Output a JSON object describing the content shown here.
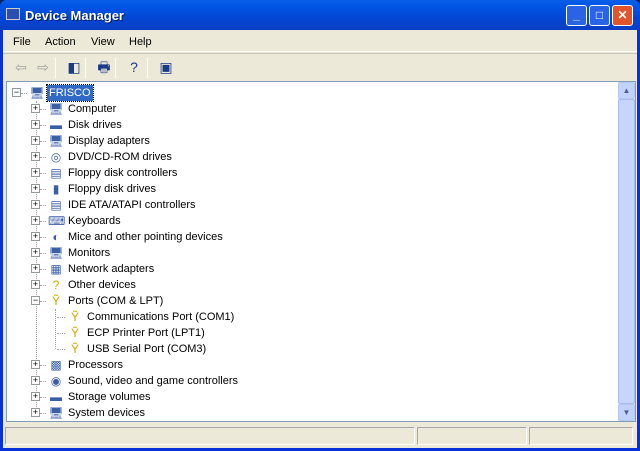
{
  "window": {
    "title": "Device Manager"
  },
  "menu": [
    "File",
    "Action",
    "View",
    "Help"
  ],
  "toolbar": [
    {
      "name": "back-icon",
      "glyph": "⇦"
    },
    {
      "name": "forward-icon",
      "glyph": "⇨"
    },
    {
      "name": "show-hide-console-tree-icon",
      "glyph": "◧"
    },
    {
      "name": "print-icon",
      "glyph": "🖶"
    },
    {
      "name": "help-icon",
      "glyph": "?"
    },
    {
      "name": "update-driver-icon",
      "glyph": "▣"
    }
  ],
  "tree": {
    "root": "FRISCO",
    "items": [
      {
        "label": "Computer",
        "icon": "computer-icon",
        "expanded": false
      },
      {
        "label": "Disk drives",
        "icon": "disk-drive-icon",
        "expanded": false
      },
      {
        "label": "Display adapters",
        "icon": "display-adapter-icon",
        "expanded": false
      },
      {
        "label": "DVD/CD-ROM drives",
        "icon": "cdrom-icon",
        "expanded": false
      },
      {
        "label": "Floppy disk controllers",
        "icon": "floppy-controller-icon",
        "expanded": false
      },
      {
        "label": "Floppy disk drives",
        "icon": "floppy-drive-icon",
        "expanded": false
      },
      {
        "label": "IDE ATA/ATAPI controllers",
        "icon": "ide-controller-icon",
        "expanded": false
      },
      {
        "label": "Keyboards",
        "icon": "keyboard-icon",
        "expanded": false
      },
      {
        "label": "Mice and other pointing devices",
        "icon": "mouse-icon",
        "expanded": false
      },
      {
        "label": "Monitors",
        "icon": "monitor-icon",
        "expanded": false
      },
      {
        "label": "Network adapters",
        "icon": "network-adapter-icon",
        "expanded": false
      },
      {
        "label": "Other devices",
        "icon": "unknown-device-icon",
        "expanded": false
      },
      {
        "label": "Ports (COM & LPT)",
        "icon": "port-icon",
        "expanded": true,
        "children": [
          "Communications Port (COM1)",
          "ECP Printer Port (LPT1)",
          "USB Serial Port (COM3)"
        ]
      },
      {
        "label": "Processors",
        "icon": "processor-icon",
        "expanded": false
      },
      {
        "label": "Sound, video and game controllers",
        "icon": "sound-icon",
        "expanded": false
      },
      {
        "label": "Storage volumes",
        "icon": "storage-volume-icon",
        "expanded": false
      },
      {
        "label": "System devices",
        "icon": "system-device-icon",
        "expanded": false
      }
    ]
  }
}
